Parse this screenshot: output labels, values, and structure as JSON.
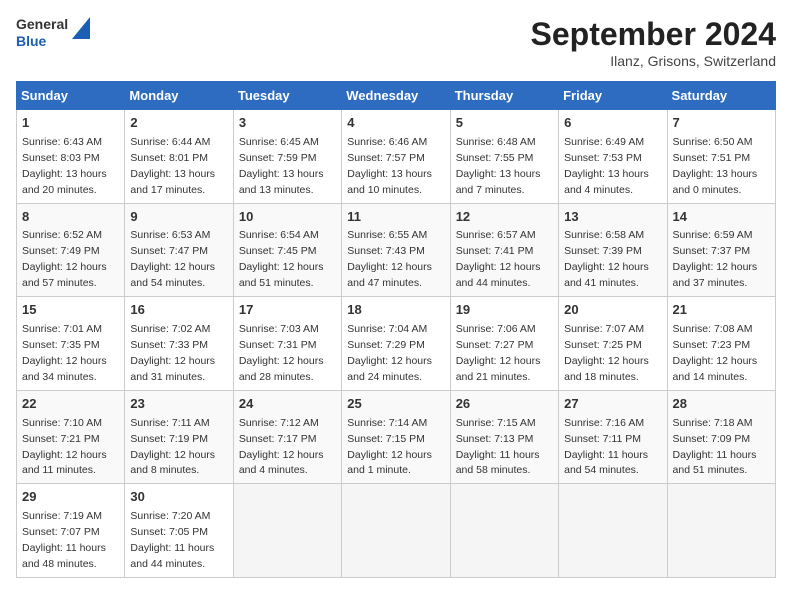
{
  "header": {
    "logo_general": "General",
    "logo_blue": "Blue",
    "month_title": "September 2024",
    "location": "Ilanz, Grisons, Switzerland"
  },
  "weekdays": [
    "Sunday",
    "Monday",
    "Tuesday",
    "Wednesday",
    "Thursday",
    "Friday",
    "Saturday"
  ],
  "weeks": [
    [
      {
        "day": "1",
        "sunrise": "6:43 AM",
        "sunset": "8:03 PM",
        "daylight": "13 hours and 20 minutes."
      },
      {
        "day": "2",
        "sunrise": "6:44 AM",
        "sunset": "8:01 PM",
        "daylight": "13 hours and 17 minutes."
      },
      {
        "day": "3",
        "sunrise": "6:45 AM",
        "sunset": "7:59 PM",
        "daylight": "13 hours and 13 minutes."
      },
      {
        "day": "4",
        "sunrise": "6:46 AM",
        "sunset": "7:57 PM",
        "daylight": "13 hours and 10 minutes."
      },
      {
        "day": "5",
        "sunrise": "6:48 AM",
        "sunset": "7:55 PM",
        "daylight": "13 hours and 7 minutes."
      },
      {
        "day": "6",
        "sunrise": "6:49 AM",
        "sunset": "7:53 PM",
        "daylight": "13 hours and 4 minutes."
      },
      {
        "day": "7",
        "sunrise": "6:50 AM",
        "sunset": "7:51 PM",
        "daylight": "13 hours and 0 minutes."
      }
    ],
    [
      {
        "day": "8",
        "sunrise": "6:52 AM",
        "sunset": "7:49 PM",
        "daylight": "12 hours and 57 minutes."
      },
      {
        "day": "9",
        "sunrise": "6:53 AM",
        "sunset": "7:47 PM",
        "daylight": "12 hours and 54 minutes."
      },
      {
        "day": "10",
        "sunrise": "6:54 AM",
        "sunset": "7:45 PM",
        "daylight": "12 hours and 51 minutes."
      },
      {
        "day": "11",
        "sunrise": "6:55 AM",
        "sunset": "7:43 PM",
        "daylight": "12 hours and 47 minutes."
      },
      {
        "day": "12",
        "sunrise": "6:57 AM",
        "sunset": "7:41 PM",
        "daylight": "12 hours and 44 minutes."
      },
      {
        "day": "13",
        "sunrise": "6:58 AM",
        "sunset": "7:39 PM",
        "daylight": "12 hours and 41 minutes."
      },
      {
        "day": "14",
        "sunrise": "6:59 AM",
        "sunset": "7:37 PM",
        "daylight": "12 hours and 37 minutes."
      }
    ],
    [
      {
        "day": "15",
        "sunrise": "7:01 AM",
        "sunset": "7:35 PM",
        "daylight": "12 hours and 34 minutes."
      },
      {
        "day": "16",
        "sunrise": "7:02 AM",
        "sunset": "7:33 PM",
        "daylight": "12 hours and 31 minutes."
      },
      {
        "day": "17",
        "sunrise": "7:03 AM",
        "sunset": "7:31 PM",
        "daylight": "12 hours and 28 minutes."
      },
      {
        "day": "18",
        "sunrise": "7:04 AM",
        "sunset": "7:29 PM",
        "daylight": "12 hours and 24 minutes."
      },
      {
        "day": "19",
        "sunrise": "7:06 AM",
        "sunset": "7:27 PM",
        "daylight": "12 hours and 21 minutes."
      },
      {
        "day": "20",
        "sunrise": "7:07 AM",
        "sunset": "7:25 PM",
        "daylight": "12 hours and 18 minutes."
      },
      {
        "day": "21",
        "sunrise": "7:08 AM",
        "sunset": "7:23 PM",
        "daylight": "12 hours and 14 minutes."
      }
    ],
    [
      {
        "day": "22",
        "sunrise": "7:10 AM",
        "sunset": "7:21 PM",
        "daylight": "12 hours and 11 minutes."
      },
      {
        "day": "23",
        "sunrise": "7:11 AM",
        "sunset": "7:19 PM",
        "daylight": "12 hours and 8 minutes."
      },
      {
        "day": "24",
        "sunrise": "7:12 AM",
        "sunset": "7:17 PM",
        "daylight": "12 hours and 4 minutes."
      },
      {
        "day": "25",
        "sunrise": "7:14 AM",
        "sunset": "7:15 PM",
        "daylight": "12 hours and 1 minute."
      },
      {
        "day": "26",
        "sunrise": "7:15 AM",
        "sunset": "7:13 PM",
        "daylight": "11 hours and 58 minutes."
      },
      {
        "day": "27",
        "sunrise": "7:16 AM",
        "sunset": "7:11 PM",
        "daylight": "11 hours and 54 minutes."
      },
      {
        "day": "28",
        "sunrise": "7:18 AM",
        "sunset": "7:09 PM",
        "daylight": "11 hours and 51 minutes."
      }
    ],
    [
      {
        "day": "29",
        "sunrise": "7:19 AM",
        "sunset": "7:07 PM",
        "daylight": "11 hours and 48 minutes."
      },
      {
        "day": "30",
        "sunrise": "7:20 AM",
        "sunset": "7:05 PM",
        "daylight": "11 hours and 44 minutes."
      },
      null,
      null,
      null,
      null,
      null
    ]
  ]
}
